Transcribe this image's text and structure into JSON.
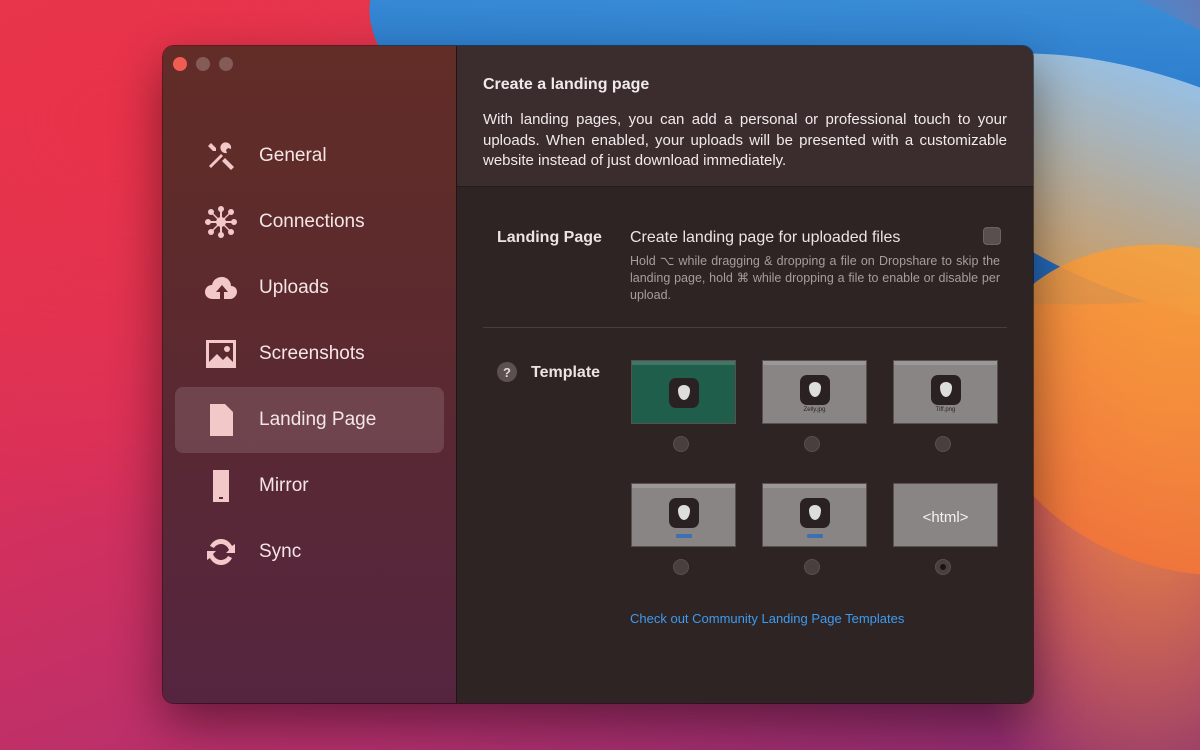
{
  "sidebar": {
    "items": [
      {
        "label": "General",
        "icon": "tools-icon"
      },
      {
        "label": "Connections",
        "icon": "network-icon"
      },
      {
        "label": "Uploads",
        "icon": "cloud-upload-icon"
      },
      {
        "label": "Screenshots",
        "icon": "image-icon"
      },
      {
        "label": "Landing Page",
        "icon": "document-icon",
        "active": true
      },
      {
        "label": "Mirror",
        "icon": "phone-icon"
      },
      {
        "label": "Sync",
        "icon": "sync-icon"
      }
    ]
  },
  "banner": {
    "title": "Create a landing page",
    "description": "With landing pages, you can add a personal or professional touch to your uploads. When enabled, your uploads will be presented with a customizable website instead of just download immediately."
  },
  "landing_page": {
    "label": "Landing Page",
    "option_title": "Create landing page for uploaded files",
    "checked": false,
    "hint": "Hold ⌥ while dragging & dropping a file on Dropshare to skip the landing page, hold ⌘ while dropping a file to enable or disable per upload."
  },
  "template": {
    "label": "Template",
    "help": "?",
    "selected_index": 5,
    "thumbs": [
      {
        "style": "green",
        "fname": ""
      },
      {
        "style": "gray",
        "fname": "Zelly.jpg"
      },
      {
        "style": "gray",
        "fname": "Tiff.png"
      },
      {
        "style": "gray",
        "fname": ""
      },
      {
        "style": "gray",
        "fname": ""
      },
      {
        "style": "html",
        "text": "<html>"
      }
    ]
  },
  "community_link": "Check out Community Landing Page Templates",
  "colors": {
    "accent_link": "#3d9bf0",
    "close_button": "#ee5c52"
  }
}
